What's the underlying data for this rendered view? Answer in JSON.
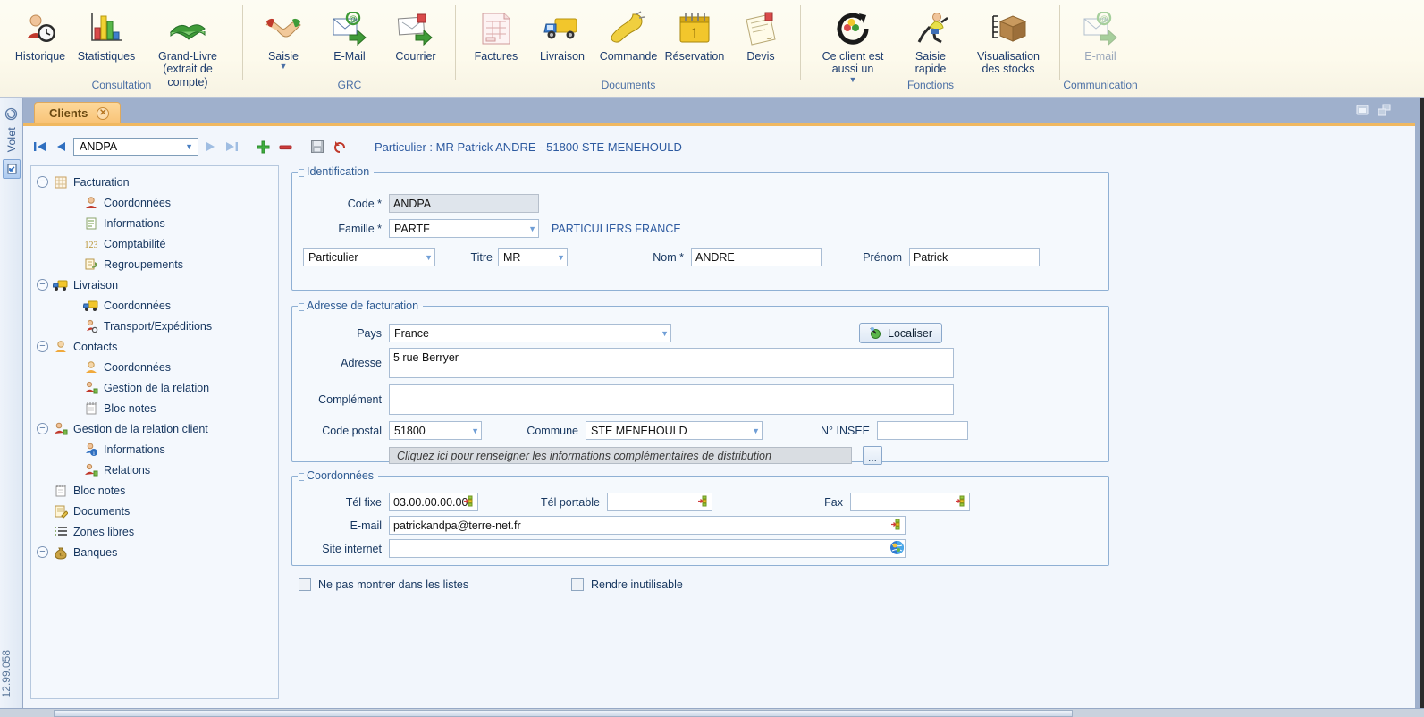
{
  "ribbon": {
    "groups": [
      {
        "title": "Consultation",
        "buttons": [
          {
            "label": "Historique",
            "icon": "history-user-clock-icon",
            "width": "normal",
            "disabled": false,
            "caret": false
          },
          {
            "label": "Statistiques",
            "icon": "bar-chart-icon",
            "width": "normal",
            "disabled": false,
            "caret": false
          },
          {
            "label": "Grand-Livre\n(extrait de compte)",
            "icon": "green-book-icon",
            "width": "xwide",
            "disabled": false,
            "caret": false
          }
        ]
      },
      {
        "title": "GRC",
        "buttons": [
          {
            "label": "Saisie",
            "icon": "handshake-icon",
            "width": "normal",
            "disabled": false,
            "caret": true
          },
          {
            "label": "E-Mail",
            "icon": "email-arrow-icon",
            "width": "normal",
            "disabled": false,
            "caret": false
          },
          {
            "label": "Courrier",
            "icon": "letter-arrow-icon",
            "width": "normal",
            "disabled": false,
            "caret": false
          }
        ]
      },
      {
        "title": "Documents",
        "buttons": [
          {
            "label": "Factures",
            "icon": "invoice-icon",
            "width": "normal",
            "disabled": false,
            "caret": false
          },
          {
            "label": "Livraison",
            "icon": "delivery-truck-icon",
            "width": "normal",
            "disabled": false,
            "caret": false
          },
          {
            "label": "Commande",
            "icon": "phone-handset-icon",
            "width": "normal",
            "disabled": false,
            "caret": false
          },
          {
            "label": "Réservation",
            "icon": "calendar-icon",
            "width": "normal",
            "disabled": false,
            "caret": false
          },
          {
            "label": "Devis",
            "icon": "quote-document-icon",
            "width": "normal",
            "disabled": false,
            "caret": false
          }
        ]
      },
      {
        "title": "Fonctions",
        "buttons": [
          {
            "label": "Ce client est\naussi un",
            "icon": "refresh-contacts-icon",
            "width": "wide",
            "disabled": false,
            "caret": true
          },
          {
            "label": "Saisie\nrapide",
            "icon": "runner-icon",
            "width": "normal",
            "disabled": false,
            "caret": false
          },
          {
            "label": "Visualisation\ndes stocks",
            "icon": "package-box-icon",
            "width": "wide",
            "disabled": false,
            "caret": false
          }
        ]
      },
      {
        "title": "Communication",
        "buttons": [
          {
            "label": "E-mail",
            "icon": "email-arrow-icon",
            "width": "normal",
            "disabled": true,
            "caret": false
          }
        ]
      }
    ]
  },
  "rail": {
    "panel_label": "Volet",
    "version": "12.99.058"
  },
  "tab": {
    "label": "Clients",
    "close": "✕"
  },
  "window_buttons": [
    {
      "name": "restore-window-icon"
    },
    {
      "name": "cascade-windows-icon"
    }
  ],
  "nav": {
    "first": "⏮",
    "prev": "◀",
    "next": "▶",
    "last": "⏭",
    "code_value": "ANDPA",
    "add": "+",
    "remove": "−",
    "save": "save-icon",
    "undo": "undo-icon",
    "record_title": "Particulier : MR Patrick ANDRE - 51800 STE MENEHOULD"
  },
  "tree": {
    "nodes": [
      {
        "label": "Facturation",
        "level": 0,
        "expander": "−",
        "icon": "invoice-grid-icon"
      },
      {
        "label": "Coordonnées",
        "level": 1,
        "expander": "",
        "icon": "red-person-icon"
      },
      {
        "label": "Informations",
        "level": 1,
        "expander": "",
        "icon": "info-list-icon"
      },
      {
        "label": "Comptabilité",
        "level": 1,
        "expander": "",
        "icon": "numbers-123-icon"
      },
      {
        "label": "Regroupements",
        "level": 1,
        "expander": "",
        "icon": "group-pages-icon"
      },
      {
        "label": "Livraison",
        "level": 0,
        "expander": "−",
        "icon": "delivery-truck-icon"
      },
      {
        "label": "Coordonnées",
        "level": 1,
        "expander": "",
        "icon": "delivery-truck-icon"
      },
      {
        "label": "Transport/Expéditions",
        "level": 1,
        "expander": "",
        "icon": "transport-icon"
      },
      {
        "label": "Contacts",
        "level": 0,
        "expander": "−",
        "icon": "orange-person-icon"
      },
      {
        "label": "Coordonnées",
        "level": 1,
        "expander": "",
        "icon": "orange-person-icon"
      },
      {
        "label": "Gestion de la relation",
        "level": 1,
        "expander": "",
        "icon": "relation-person-icon"
      },
      {
        "label": "Bloc notes",
        "level": 1,
        "expander": "",
        "icon": "notepad-icon"
      },
      {
        "label": "Gestion de la relation client",
        "level": 0,
        "expander": "−",
        "icon": "relation-client-icon"
      },
      {
        "label": "Informations",
        "level": 1,
        "expander": "",
        "icon": "person-info-icon"
      },
      {
        "label": "Relations",
        "level": 1,
        "expander": "",
        "icon": "relation-person-icon"
      },
      {
        "label": "Bloc notes",
        "level": 0,
        "expander": "",
        "icon": "notepad-icon"
      },
      {
        "label": "Documents",
        "level": 0,
        "expander": "",
        "icon": "document-pencil-icon"
      },
      {
        "label": "Zones libres",
        "level": 0,
        "expander": "",
        "icon": "list-lines-icon"
      },
      {
        "label": "Banques",
        "level": 0,
        "expander": "−",
        "icon": "money-bag-icon"
      }
    ]
  },
  "form": {
    "identification": {
      "legend": "Identification",
      "code_label": "Code *",
      "code_value": "ANDPA",
      "famille_label": "Famille *",
      "famille_value": "PARTF",
      "famille_note": "PARTICULIERS FRANCE",
      "type_value": "Particulier",
      "titre_label": "Titre",
      "titre_value": "MR",
      "nom_label": "Nom *",
      "nom_value": "ANDRE",
      "prenom_label": "Prénom",
      "prenom_value": "Patrick"
    },
    "adresse": {
      "legend": "Adresse de facturation",
      "pays_label": "Pays",
      "pays_value": "France",
      "localiser_label": "Localiser",
      "adresse_label": "Adresse",
      "adresse_value": "5 rue Berryer",
      "complement_label": "Complément",
      "complement_value": "",
      "cp_label": "Code postal",
      "cp_value": "51800",
      "commune_label": "Commune",
      "commune_value": "STE MENEHOULD",
      "insee_label": "N° INSEE",
      "insee_value": "",
      "distribution_text": "Cliquez ici pour renseigner les informations complémentaires de distribution",
      "dots_label": "..."
    },
    "coordonnees": {
      "legend": "Coordonnées",
      "tel_fixe_label": "Tél fixe",
      "tel_fixe_value": "03.00.00.00.00",
      "tel_portable_label": "Tél portable",
      "tel_portable_value": "",
      "fax_label": "Fax",
      "fax_value": "",
      "email_label": "E-mail",
      "email_value": "patrickandpa@terre-net.fr",
      "site_label": "Site internet",
      "site_value": ""
    },
    "checkboxes": [
      {
        "label": "Ne pas montrer dans les listes",
        "checked": false
      },
      {
        "label": "Rendre inutilisable",
        "checked": false
      }
    ]
  }
}
